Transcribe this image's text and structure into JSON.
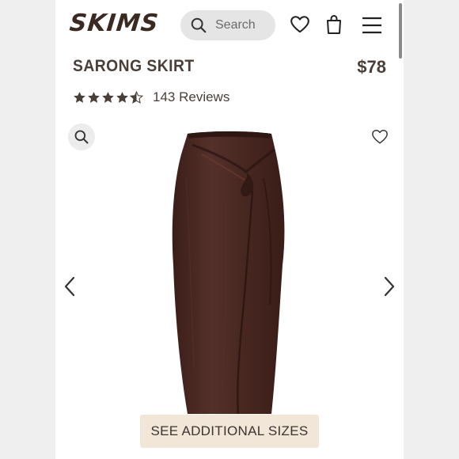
{
  "header": {
    "logo_text": "SKIMS",
    "search_placeholder": "Search",
    "icons": [
      "search-icon",
      "heart-icon",
      "shopping-bag-icon",
      "hamburger-menu-icon"
    ]
  },
  "product": {
    "name": "SARONG SKIRT",
    "price": "$78",
    "rating": 4.5,
    "reviews_label": "143 Reviews",
    "color": "#4a2a22"
  },
  "gallery": {
    "icons": [
      "zoom-icon",
      "wishlist-heart-icon",
      "chevron-left-icon",
      "chevron-right-icon"
    ]
  },
  "actions": {
    "sizes_label": "SEE ADDITIONAL SIZES"
  },
  "colors": {
    "brand_text": "#3a2a22",
    "button_bg": "#f1e6d8",
    "page_bg": "#ffffff"
  }
}
